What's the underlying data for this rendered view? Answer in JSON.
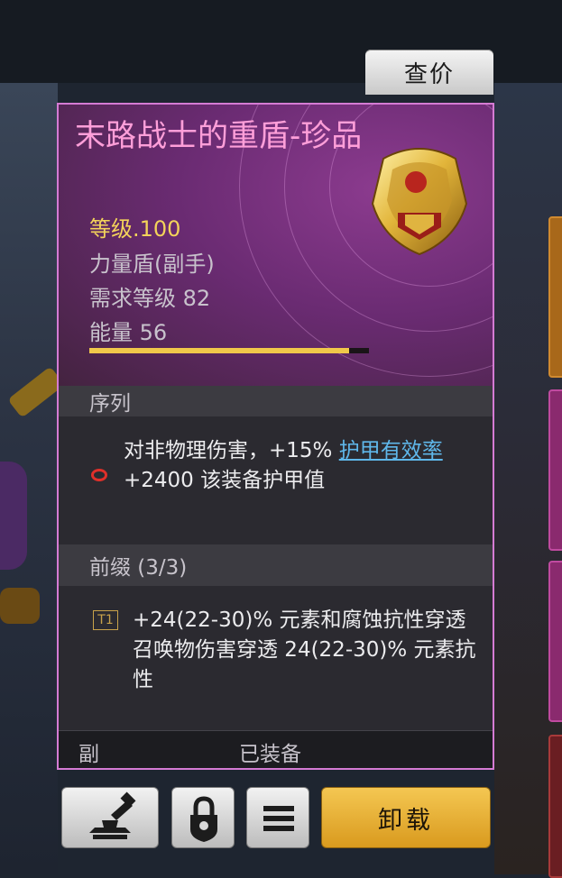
{
  "price_button": "查价",
  "item": {
    "name": "末路战士的重盾-珍品",
    "level": "等级.100",
    "type": "力量盾(副手)",
    "required_level": "需求等级 82",
    "energy": "能量 56",
    "energy_fraction": 0.93
  },
  "sequence": {
    "header": "序列",
    "text_before": "对非物理伤害，+15% ",
    "link": "护甲有效率",
    "line2": "+2400 该装备护甲值"
  },
  "prefix": {
    "header": "前缀 (3/3)",
    "tier": "T1",
    "lines": [
      "+24(22-30)% 元素和腐蚀抗性穿透",
      "召唤物伤害穿透 24(22-30)% 元素抗性"
    ]
  },
  "footer": {
    "slot": "副",
    "state": "已装备"
  },
  "actions": {
    "smith_icon": "anvil-hammer-icon",
    "lock_icon": "lock-icon",
    "menu_icon": "menu-icon",
    "unload": "卸载"
  },
  "colors": {
    "title": "#ff9fd9",
    "level": "#f3d35a",
    "link": "#5fb7ea",
    "card_border": "#d57bd4",
    "unload_button": "#f4c752"
  }
}
